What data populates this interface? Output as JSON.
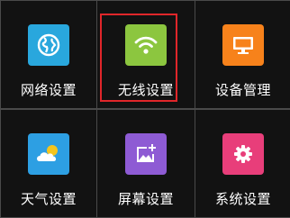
{
  "tiles": [
    {
      "label": "网络设置",
      "icon": "globe-icon",
      "color": "#29a7dd",
      "selected": false
    },
    {
      "label": "无线设置",
      "icon": "wifi-icon",
      "color": "#8cc63f",
      "selected": true
    },
    {
      "label": "设备管理",
      "icon": "monitor-icon",
      "color": "#f7821b",
      "selected": false
    },
    {
      "label": "天气设置",
      "icon": "weather-icon",
      "color": "#2d9fe3",
      "selected": false
    },
    {
      "label": "屏幕设置",
      "icon": "screen-edit-icon",
      "color": "#8e5bd4",
      "selected": false
    },
    {
      "label": "系统设置",
      "icon": "gear-icon",
      "color": "#e83e7a",
      "selected": false
    }
  ],
  "selection_color": "#e0262a"
}
